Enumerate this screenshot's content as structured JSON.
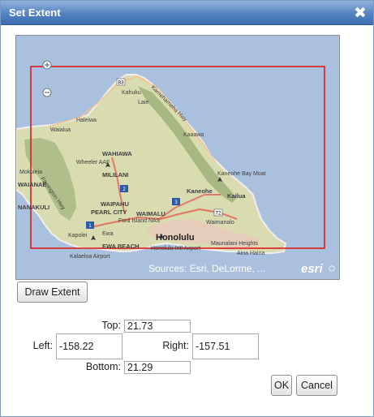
{
  "dialog": {
    "title": "Set Extent",
    "close_glyph": "✖"
  },
  "map": {
    "attribution": "Sources: Esri, DeLorme, ...",
    "logo_text": "esri",
    "selection_color": "#e0191c",
    "water_color": "#a9c1de",
    "land_color": "#d9dcb0",
    "place_labels": [
      "Kahuku",
      "Laie",
      "Haleiwa",
      "Waialua",
      "Kaaawa",
      "Kaneohe Bay Moat",
      "Kaneohe",
      "Kailua",
      "WAHIAWA",
      "Wheeler AAF",
      "MILILANI",
      "Mokuleia",
      "Farrington Hwy",
      "WAIPAHU",
      "PEARL CITY",
      "Ford Island NAS",
      "NANAKULI",
      "Kapolei",
      "Ewa",
      "EWA BEACH",
      "Kalaeloa Airport",
      "Honolulu",
      "Honolulu Intl Airport",
      "Waimanalo",
      "Maunalani Heights",
      "Aina Haina",
      "WAIMALU",
      "Kamehameha Hwy",
      "WAIANAE"
    ],
    "shields": [
      "83",
      "2",
      "3",
      "72",
      "1"
    ],
    "icons": [
      "zoom-in-icon",
      "zoom-out-icon",
      "airport-icon"
    ]
  },
  "draw_extent_label": "Draw Extent",
  "extent": {
    "top_label": "Top:",
    "top_value": "21.73",
    "left_label": "Left:",
    "left_value": "-158.22",
    "right_label": "Right:",
    "right_value": "-157.51",
    "bottom_label": "Bottom:",
    "bottom_value": "21.29"
  },
  "ok_label": "OK",
  "cancel_label": "Cancel"
}
